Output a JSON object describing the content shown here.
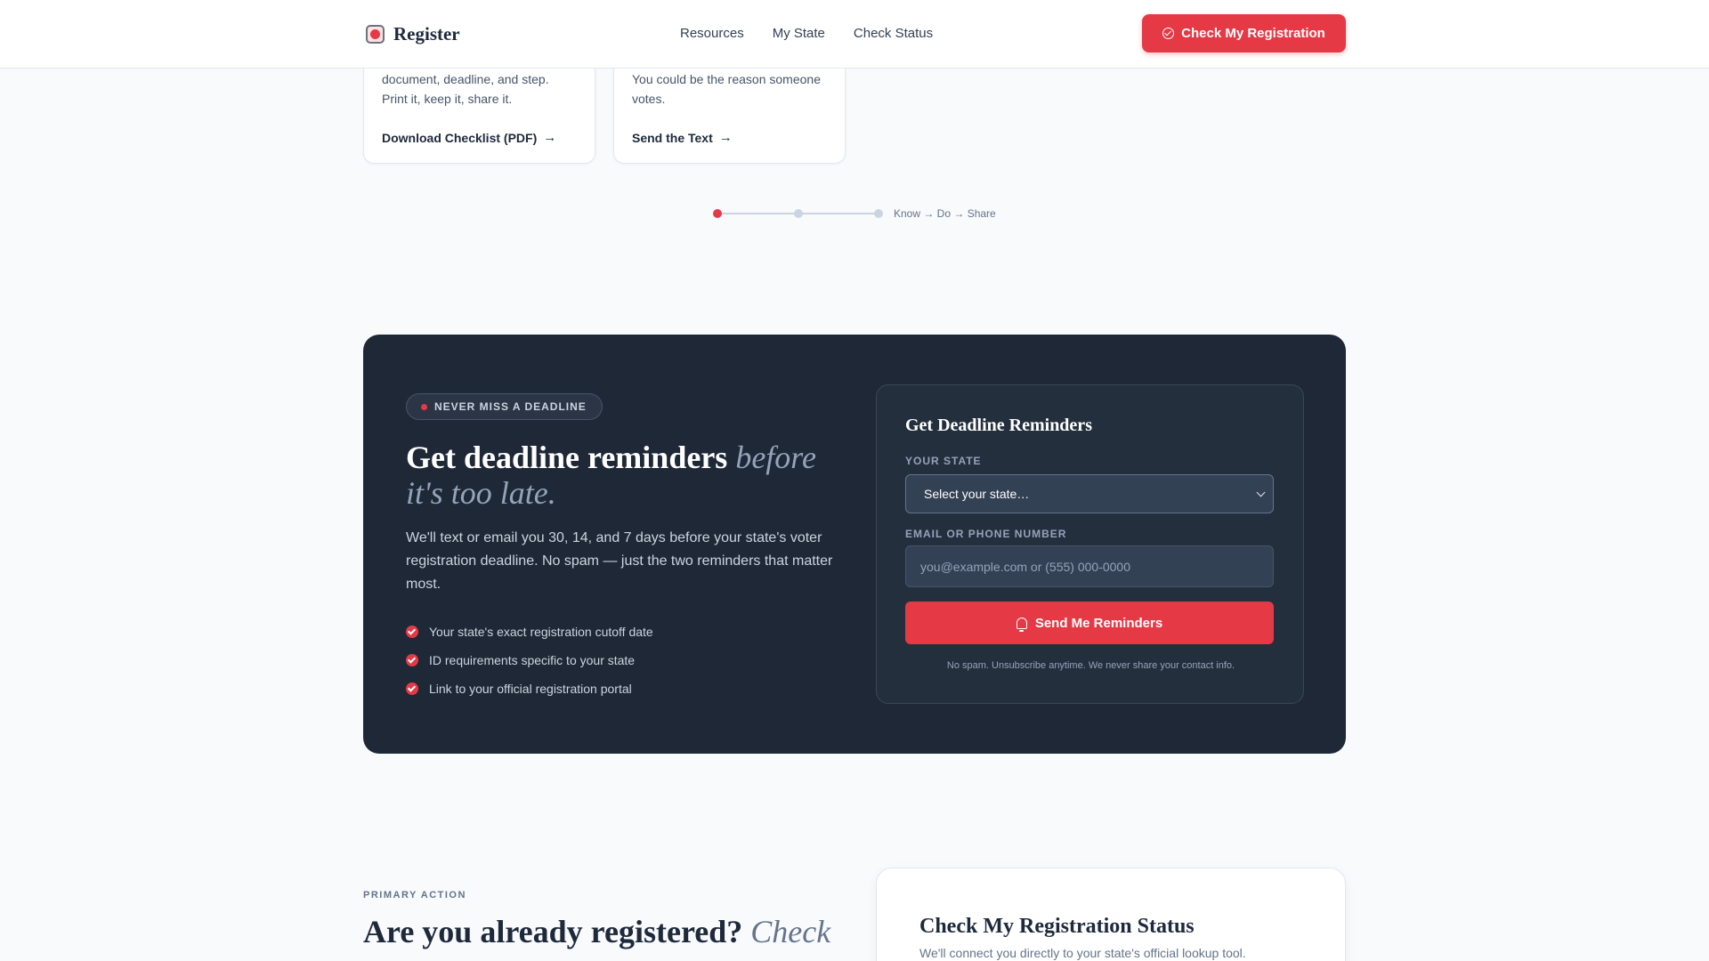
{
  "header": {
    "brand": "Register",
    "nav": [
      "Resources",
      "My State",
      "Check Status"
    ],
    "cta_label": "Check My Registration"
  },
  "cards": [
    {
      "text": "document, deadline, and step. Print it, keep it, share it.",
      "link": "Download Checklist (PDF)"
    },
    {
      "text": "You could be the reason someone votes.",
      "link": "Send the Text"
    }
  ],
  "stepper": {
    "label": "Know → Do → Share",
    "active_step": 1,
    "steps": 3
  },
  "reminders": {
    "pill": "NEVER MISS A DEADLINE",
    "title_main": "Get deadline reminders",
    "title_italic": "before it's too late.",
    "body": "We'll text or email you 30, 14, and 7 days before your state's voter registration deadline. No spam — just the two reminders that matter most.",
    "bullets": [
      "Your state's exact registration cutoff date",
      "ID requirements specific to your state",
      "Link to your official registration portal"
    ],
    "form": {
      "title": "Get Deadline Reminders",
      "state_label": "YOUR STATE",
      "state_value": "Select your state…",
      "contact_label": "EMAIL OR PHONE NUMBER",
      "contact_placeholder": "you@example.com or (555) 000-0000",
      "submit_label": "Send Me Reminders",
      "note": "No spam. Unsubscribe anytime. We never share your contact info."
    }
  },
  "primary": {
    "eyebrow": "PRIMARY ACTION",
    "title_main": "Are you already registered?",
    "title_italic": "Check right now.",
    "card_title": "Check My Registration Status",
    "card_sub": "We'll connect you directly to your state's official lookup tool."
  },
  "colors": {
    "accent": "#e63946",
    "dark_panel": "#1e2836"
  }
}
